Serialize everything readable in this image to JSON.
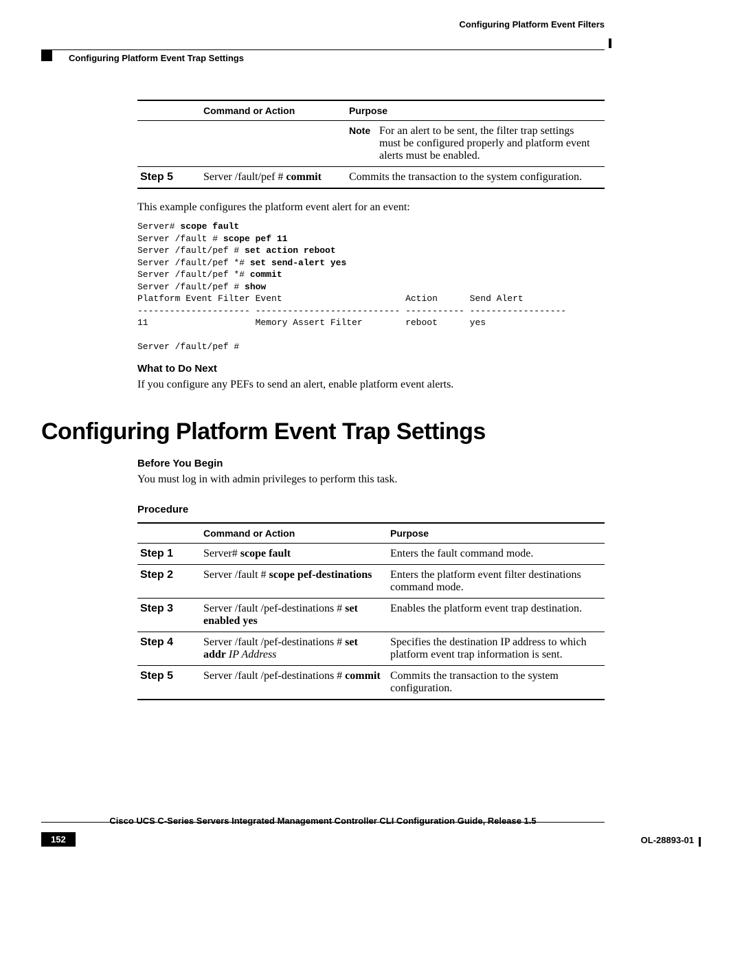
{
  "header": {
    "right": "Configuring Platform Event Filters",
    "left": "Configuring Platform Event Trap Settings"
  },
  "table1": {
    "headers": {
      "cmd": "Command or Action",
      "purpose": "Purpose"
    },
    "note_label": "Note",
    "note_text": "For an alert to be sent, the filter trap settings must be configured properly and platform event alerts must be enabled.",
    "step5_label": "Step 5",
    "step5_cmd_prefix": "Server /fault/pef # ",
    "step5_cmd_bold": "commit",
    "step5_purpose": "Commits the transaction to the system configuration."
  },
  "example_intro": "This example configures the platform event alert for an event:",
  "cli": "Server# scope fault\nServer /fault # scope pef 11\nServer /fault/pef # set action reboot\nServer /fault/pef *# set send-alert yes\nServer /fault/pef *# commit\nServer /fault/pef # show\nPlatform Event Filter Event                       Action      Send Alert\n--------------------- --------------------------- ----------- ------------------\n11                    Memory Assert Filter        reboot      yes\n\nServer /fault/pef #",
  "cli_bold_tokens": [
    "scope fault",
    "scope pef 11",
    "set action reboot",
    "set send-alert yes",
    "commit",
    "show"
  ],
  "what_next_heading": "What to Do Next",
  "what_next_text": "If you configure any PEFs to send an alert, enable platform event alerts.",
  "section_title": "Configuring Platform Event Trap Settings",
  "before_heading": "Before You Begin",
  "before_text": "You must log in with admin privileges to perform this task.",
  "procedure_heading": "Procedure",
  "table2": {
    "headers": {
      "cmd": "Command or Action",
      "purpose": "Purpose"
    },
    "rows": [
      {
        "step": "Step 1",
        "prefix": "Server# ",
        "bold": "scope fault",
        "italic": "",
        "purpose": "Enters the fault command mode."
      },
      {
        "step": "Step 2",
        "prefix": "Server /fault # ",
        "bold": "scope pef-destinations",
        "italic": "",
        "purpose": "Enters the platform event filter destinations command mode."
      },
      {
        "step": "Step 3",
        "prefix": "Server /fault /pef-destinations # ",
        "bold": "set enabled yes",
        "italic": "",
        "purpose": "Enables the platform event trap destination."
      },
      {
        "step": "Step 4",
        "prefix": "Server /fault /pef-destinations # ",
        "bold": "set addr",
        "italic": "IP Address",
        "purpose": "Specifies the destination IP address to which platform event trap information is sent."
      },
      {
        "step": "Step 5",
        "prefix": "Server /fault /pef-destinations # ",
        "bold": "commit",
        "italic": "",
        "purpose": "Commits the transaction to the system configuration."
      }
    ]
  },
  "footer": {
    "title": "Cisco UCS C-Series Servers Integrated Management Controller CLI Configuration Guide, Release 1.5",
    "page": "152",
    "docid": "OL-28893-01"
  }
}
